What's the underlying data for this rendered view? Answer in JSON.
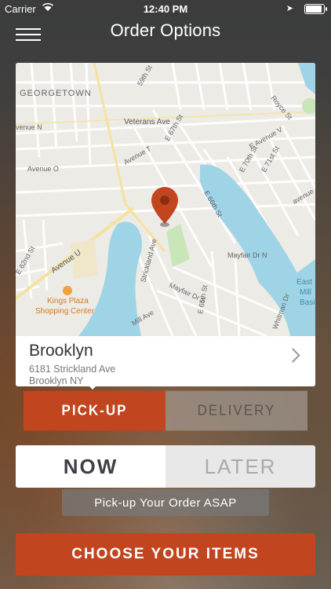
{
  "status_bar": {
    "carrier": "Carrier",
    "time": "12:40 PM",
    "battery_level": 1.0
  },
  "header": {
    "title": "Order Options"
  },
  "map": {
    "labels": {
      "georgetown": "GEORGETOWN",
      "veterans_ave": "Veterans Ave",
      "avenue_n": "venue N",
      "avenue_o": "Avenue O",
      "avenue_t": "Avenue T",
      "avenue_u": "Avenue U",
      "avenue_v": "E Avenue V",
      "e67th": "E 67th St",
      "e66th": "E 66th St",
      "e65th": "E 65th St",
      "e70th": "E 70th St",
      "e71st": "E 71st St",
      "e62nd": "E 62nd St",
      "e59th": "59th St",
      "royce": "Royce St",
      "strickland": "Strickland Ave",
      "mayfair_dr_n": "Mayfair Dr N",
      "mayfair_dr_s": "Mayfair Dr S",
      "mill_ave": "Mill Ave",
      "whitman": "Whitman Dr",
      "kings_plaza_1": "Kings Plaza",
      "kings_plaza_2": "Shopping Center",
      "east_mill_basin_1": "East",
      "east_mill_basin_2": "Mill",
      "east_mill_basin_3": "Basin",
      "ave_label_right": "avenue"
    }
  },
  "location": {
    "name": "Brooklyn",
    "address_line1": "6181 Strickland Ave",
    "address_line2": "Brooklyn NY"
  },
  "order_type": {
    "pickup": "PICK-UP",
    "delivery": "DELIVERY",
    "selected": "pickup"
  },
  "timing": {
    "now": "NOW",
    "later": "LATER",
    "selected": "now",
    "note": "Pick-up Your Order ASAP"
  },
  "cta": {
    "label": "CHOOSE YOUR ITEMS"
  },
  "colors": {
    "accent": "#c1461f",
    "map_water": "#9fd4e6",
    "map_park": "#c8e6b8",
    "map_road": "#ffffff",
    "map_highway": "#f6e29e"
  }
}
